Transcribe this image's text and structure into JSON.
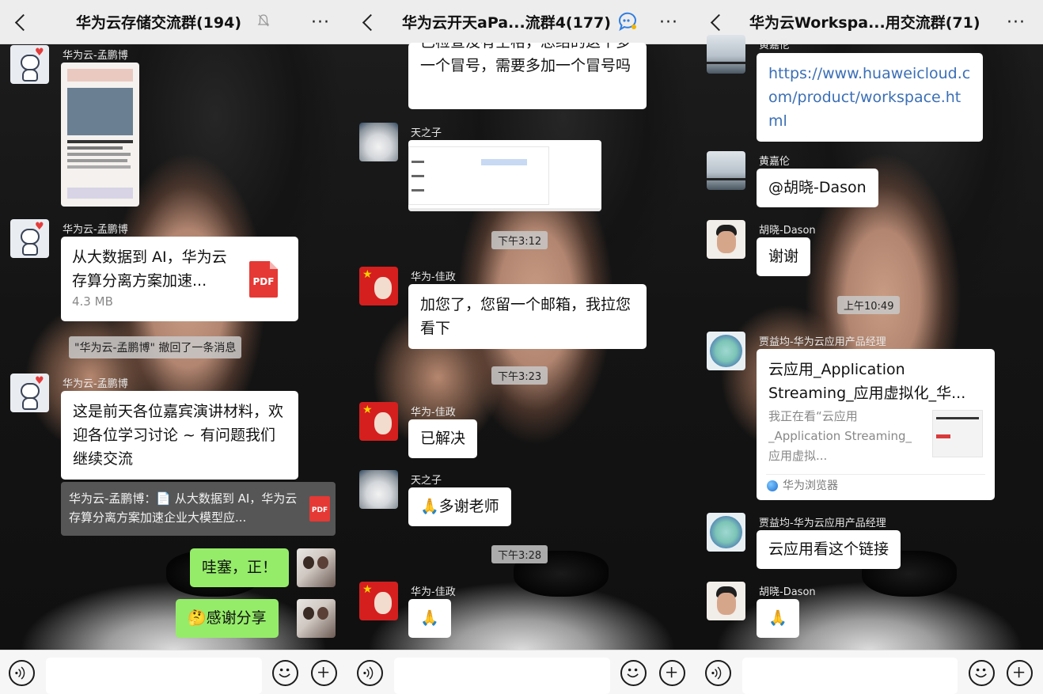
{
  "panels": [
    {
      "title": "华为云存储交流群(194)",
      "messages": {
        "sender1": "华为云-孟鹏博",
        "sender2": "华为云-孟鹏博",
        "sender3": "华为云-孟鹏博",
        "file_name": "从大数据到 AI，华为云存算分离方案加速...",
        "file_size": "4.3 MB",
        "file_type": "PDF",
        "recall": "\"华为云-孟鹏博\" 撤回了一条消息",
        "text1": "这是前天各位嘉宾演讲材料，欢迎各位学习讨论 ~ 有问题我们继续交流",
        "quote": "华为云-孟鹏博：📄 从大数据到 AI，华为云存算分离方案加速企业大模型应...",
        "quote_file_type": "PDF",
        "mine1": "哇塞，正！",
        "mine2": "🤔感谢分享"
      }
    },
    {
      "title": "华为云开天aPa...流群4(177)",
      "messages": {
        "text_top": "已检查没有空格，总结的这个多一个冒号，需要多加一个冒号吗",
        "sender_a": "天之子",
        "time1": "下午3:12",
        "sender_b": "华为-佳政",
        "text_b": "加您了，您留一个邮箱，我拉您看下",
        "time2": "下午3:23",
        "sender_c": "华为-佳政",
        "text_c": "已解决",
        "sender_d": "天之子",
        "text_d": "🙏多谢老师",
        "time3": "下午3:28",
        "sender_e": "华为-佳政",
        "text_e": "🙏"
      }
    },
    {
      "title": "华为云Workspa...用交流群(71)",
      "messages": {
        "sender_top": "黄嘉伦",
        "link": "https://www.huaweicloud.com/product/workspace.html",
        "sender_a": "黄嘉伦",
        "text_a": "@胡晓-Dason",
        "sender_b": "胡晓-Dason",
        "text_b": "谢谢",
        "time1": "上午10:49",
        "sender_c": "贾益均-华为云应用产品经理",
        "card_title": "云应用_Application Streaming_应用虚拟化_华...",
        "card_desc": "我正在看“云应用_Application Streaming_应用虚拟...",
        "card_source": "华为浏览器",
        "sender_d": "贾益均-华为云应用产品经理",
        "text_d": "云应用看这个链接",
        "sender_e": "胡晓-Dason",
        "text_e": "🙏"
      }
    }
  ],
  "ui": {
    "more": "···",
    "accent_green": "#95ec69",
    "pdf_red": "#e53935"
  }
}
